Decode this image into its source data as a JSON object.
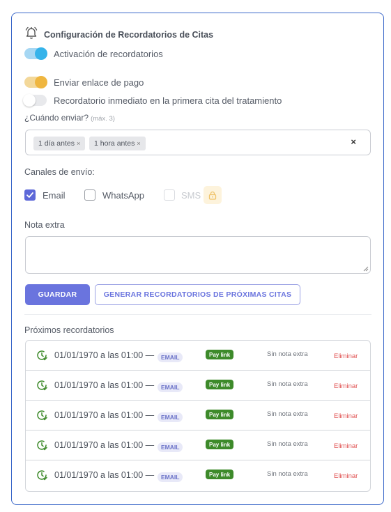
{
  "header": {
    "title": "Configuración de Recordatorios de Citas",
    "icon": "bell-icon"
  },
  "toggles": [
    {
      "label": "Activación de recordatorios",
      "state": "on",
      "color": "#35b3ea"
    },
    {
      "label": "Enviar enlace de pago",
      "state": "on",
      "color": "#efb640"
    },
    {
      "label": "Recordatorio inmediato en la primera cita del tratamiento",
      "state": "off"
    }
  ],
  "when": {
    "label": "¿Cuándo enviar?",
    "hint": "(máx. 3)",
    "chips": [
      "1 día antes",
      "1 hora antes"
    ],
    "chip_remove": "×",
    "clear": "×"
  },
  "channels": {
    "label": "Canales de envío:",
    "options": [
      {
        "label": "Email",
        "checked": true,
        "disabled": false
      },
      {
        "label": "WhatsApp",
        "checked": false,
        "disabled": false
      },
      {
        "label": "SMS",
        "checked": false,
        "disabled": true,
        "icon": "lock-icon"
      }
    ]
  },
  "note": {
    "label": "Nota extra",
    "value": ""
  },
  "actions": {
    "save": "GUARDAR",
    "generate": "GENERAR RECORDATORIOS DE PRÓXIMAS CITAS"
  },
  "upcoming": {
    "label": "Próximos recordatorios",
    "rows": [
      {
        "date": "01/01/1970 a las 01:00 —",
        "channel": "EMAIL",
        "pay": "Pay link",
        "note": "Sin nota extra",
        "delete": "Eliminar"
      },
      {
        "date": "01/01/1970 a las 01:00 —",
        "channel": "EMAIL",
        "pay": "Pay link",
        "note": "Sin nota extra",
        "delete": "Eliminar"
      },
      {
        "date": "01/01/1970 a las 01:00 —",
        "channel": "EMAIL",
        "pay": "Pay link",
        "note": "Sin nota extra",
        "delete": "Eliminar"
      },
      {
        "date": "01/01/1970 a las 01:00 —",
        "channel": "EMAIL",
        "pay": "Pay link",
        "note": "Sin nota extra",
        "delete": "Eliminar"
      },
      {
        "date": "01/01/1970 a las 01:00 —",
        "channel": "EMAIL",
        "pay": "Pay link",
        "note": "Sin nota extra",
        "delete": "Eliminar"
      }
    ]
  },
  "colors": {
    "accent": "#6a74de",
    "border": "#3a67c9",
    "danger": "#e15252",
    "pay": "#3d8a2a"
  }
}
